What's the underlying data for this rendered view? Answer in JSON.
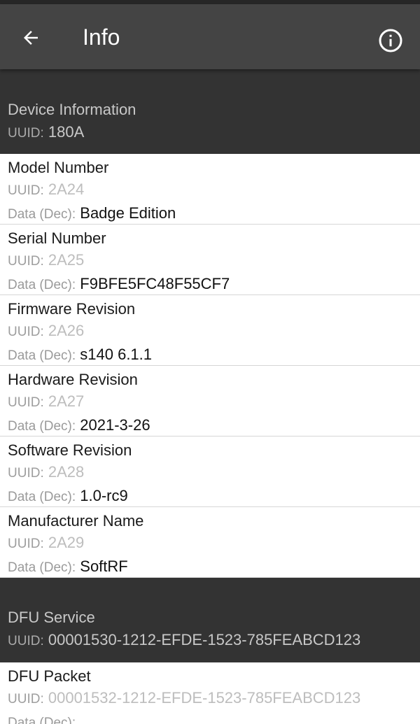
{
  "appbar": {
    "title": "Info"
  },
  "labels": {
    "uuid": "UUID:",
    "data_dec": "Data (Dec):"
  },
  "services": [
    {
      "name": "Device Information",
      "uuid": "180A",
      "characteristics": [
        {
          "name": "Model Number",
          "uuid": "2A24",
          "data": "Badge Edition"
        },
        {
          "name": "Serial Number",
          "uuid": "2A25",
          "data": "F9BFE5FC48F55CF7"
        },
        {
          "name": "Firmware Revision",
          "uuid": "2A26",
          "data": "s140 6.1.1"
        },
        {
          "name": "Hardware Revision",
          "uuid": "2A27",
          "data": "2021-3-26"
        },
        {
          "name": "Software Revision",
          "uuid": "2A28",
          "data": "1.0-rc9"
        },
        {
          "name": "Manufacturer Name",
          "uuid": "2A29",
          "data": "SoftRF"
        }
      ]
    },
    {
      "name": "DFU Service",
      "uuid": "00001530-1212-EFDE-1523-785FEABCD123",
      "characteristics": [
        {
          "name": "DFU Packet",
          "uuid": "00001532-1212-EFDE-1523-785FEABCD123",
          "data": ""
        }
      ]
    }
  ],
  "icons": {
    "back": "arrow-left-icon",
    "info": "info-circle-icon"
  },
  "colors": {
    "appbar": "#444444",
    "service_header": "#333333",
    "status_bar": "#262626"
  }
}
